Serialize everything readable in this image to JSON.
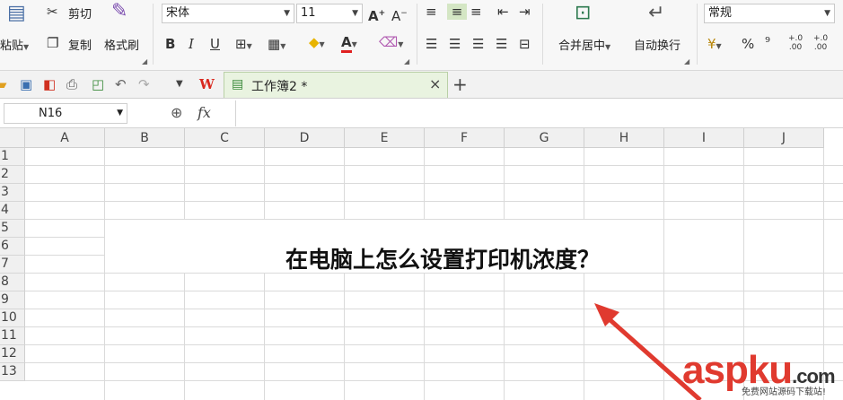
{
  "ribbon": {
    "paste_label": "粘贴",
    "cut_label": "剪切",
    "copy_label": "复制",
    "format_painter_label": "格式刷",
    "font_name": "宋体",
    "font_size": "11",
    "bold": "B",
    "italic": "I",
    "underline": "U",
    "increase_font": "A⁺",
    "decrease_font": "A⁻",
    "font_color_glyph": "A",
    "merge_center_label": "合并居中",
    "wrap_text_label": "自动换行",
    "number_format": "常规",
    "percent": "%",
    "comma": "⁹",
    "inc_decimal": "+.0 .00",
    "dec_decimal": "+.0 .00"
  },
  "quick_bar": {
    "doc_tab_title": "工作簿2 *",
    "wps_logo": "W",
    "close_tab": "×",
    "new_tab": "+"
  },
  "formula_bar": {
    "name_box": "N16",
    "fx": "fx",
    "formula": ""
  },
  "sheet": {
    "columns": [
      "A",
      "B",
      "C",
      "D",
      "E",
      "F",
      "G",
      "H",
      "I",
      "J"
    ],
    "rows": [
      "1",
      "2",
      "3",
      "4",
      "5",
      "6",
      "7",
      "8",
      "9",
      "10",
      "11",
      "12",
      "13"
    ],
    "cell_text": "在电脑上怎么设置打印机浓度？"
  },
  "watermark": {
    "brand": "aspku",
    "tld": ".com",
    "tagline": "免费网站源码下载站!"
  },
  "colors": {
    "accent_green": "#e9f3e0",
    "annotation_red": "#e03a2f",
    "wps_red": "#d9281e"
  }
}
